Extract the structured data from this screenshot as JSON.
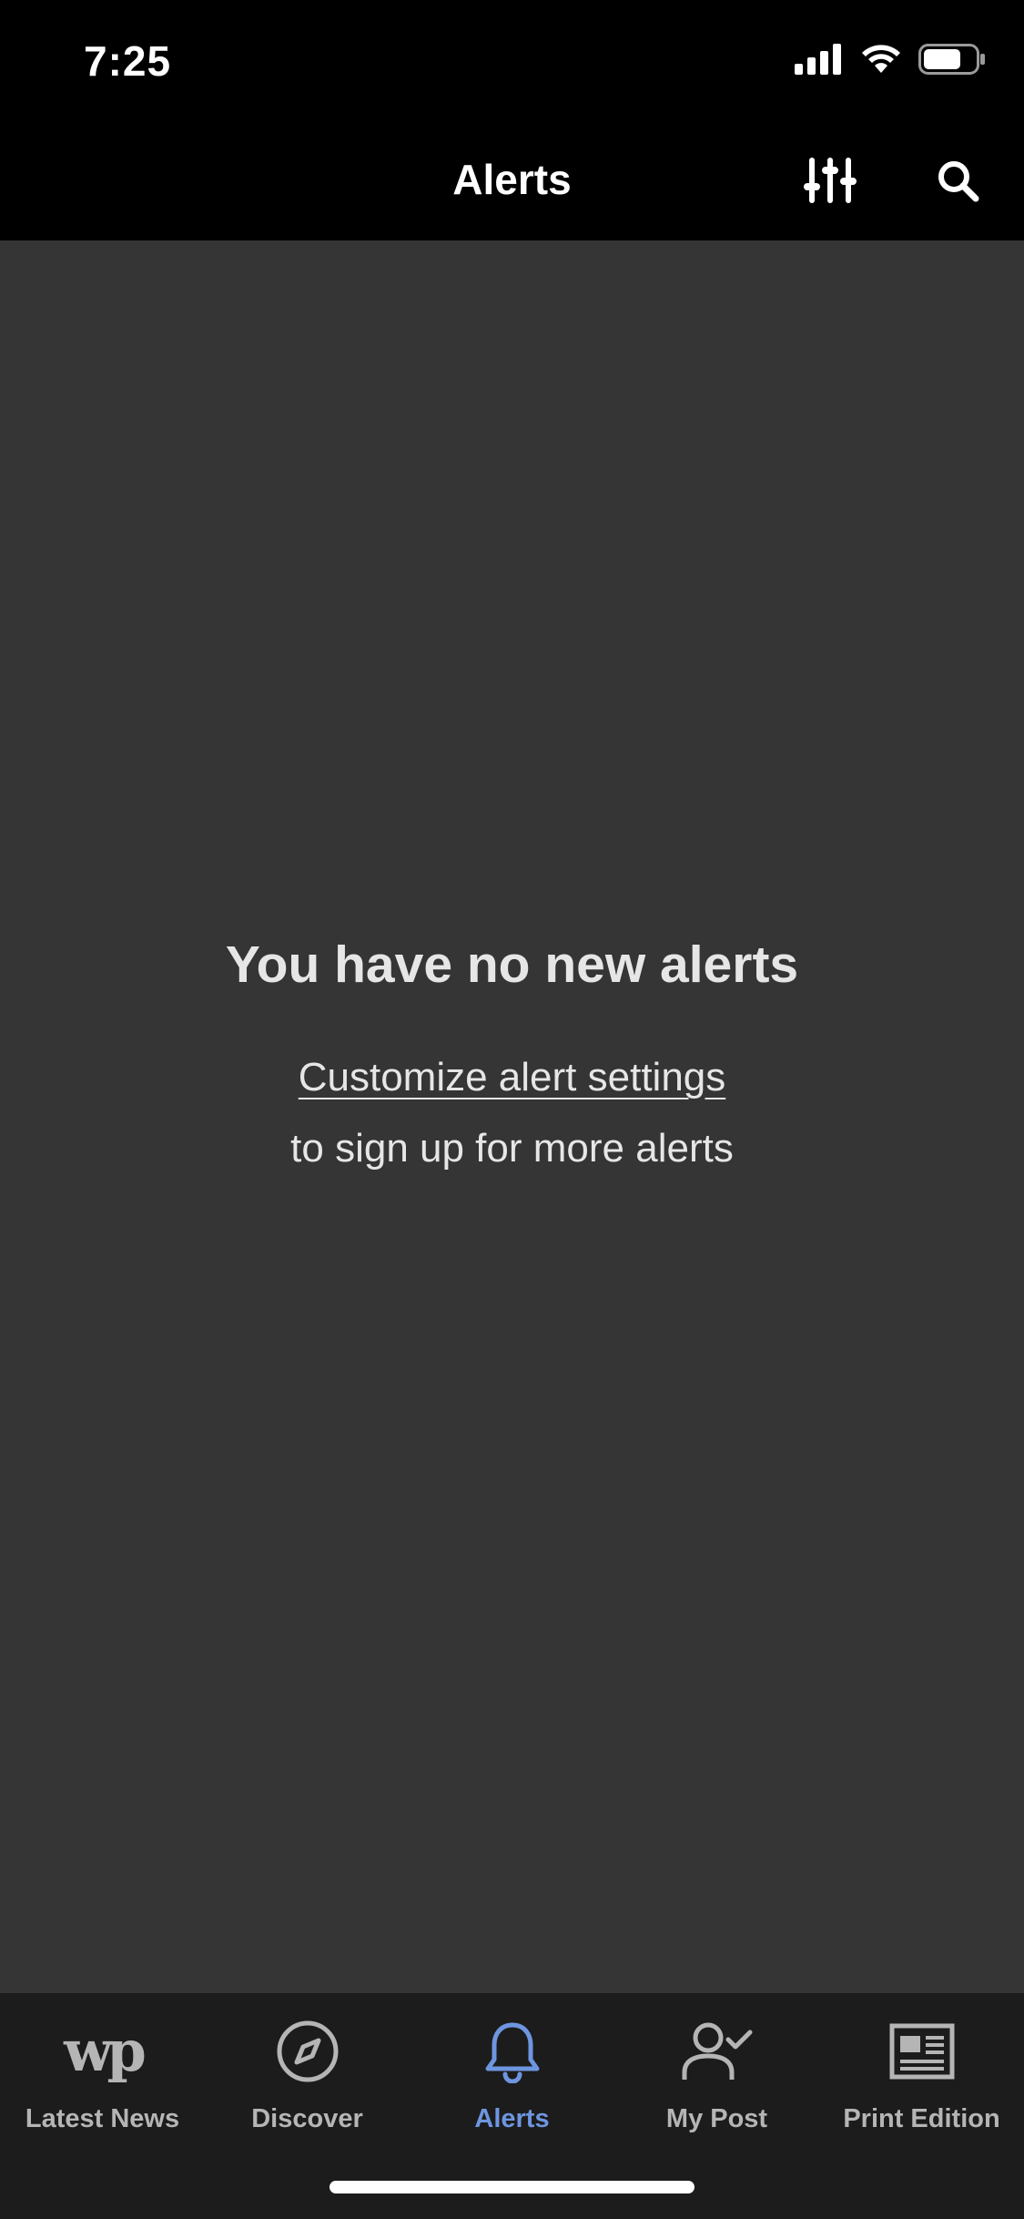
{
  "status_bar": {
    "time": "7:25"
  },
  "header": {
    "title": "Alerts",
    "filters_icon": "sliders-icon",
    "search_icon": "search-icon"
  },
  "empty_state": {
    "title": "You have no new alerts",
    "link_text": "Customize alert settings",
    "subtitle": "to sign up for more alerts"
  },
  "bottom_nav": {
    "items": [
      {
        "label": "Latest News",
        "icon": "wp-logo-icon",
        "logo_text": "wp",
        "active": false
      },
      {
        "label": "Discover",
        "icon": "compass-icon",
        "active": false
      },
      {
        "label": "Alerts",
        "icon": "bell-icon",
        "active": true
      },
      {
        "label": "My Post",
        "icon": "person-check-icon",
        "active": false
      },
      {
        "label": "Print Edition",
        "icon": "newspaper-icon",
        "active": false
      }
    ]
  },
  "colors": {
    "background": "#353535",
    "header": "#000000",
    "nav_background": "#1c1c1c",
    "active": "#6e95e0",
    "inactive": "#b5b5b5",
    "text": "#e6e6e6"
  }
}
